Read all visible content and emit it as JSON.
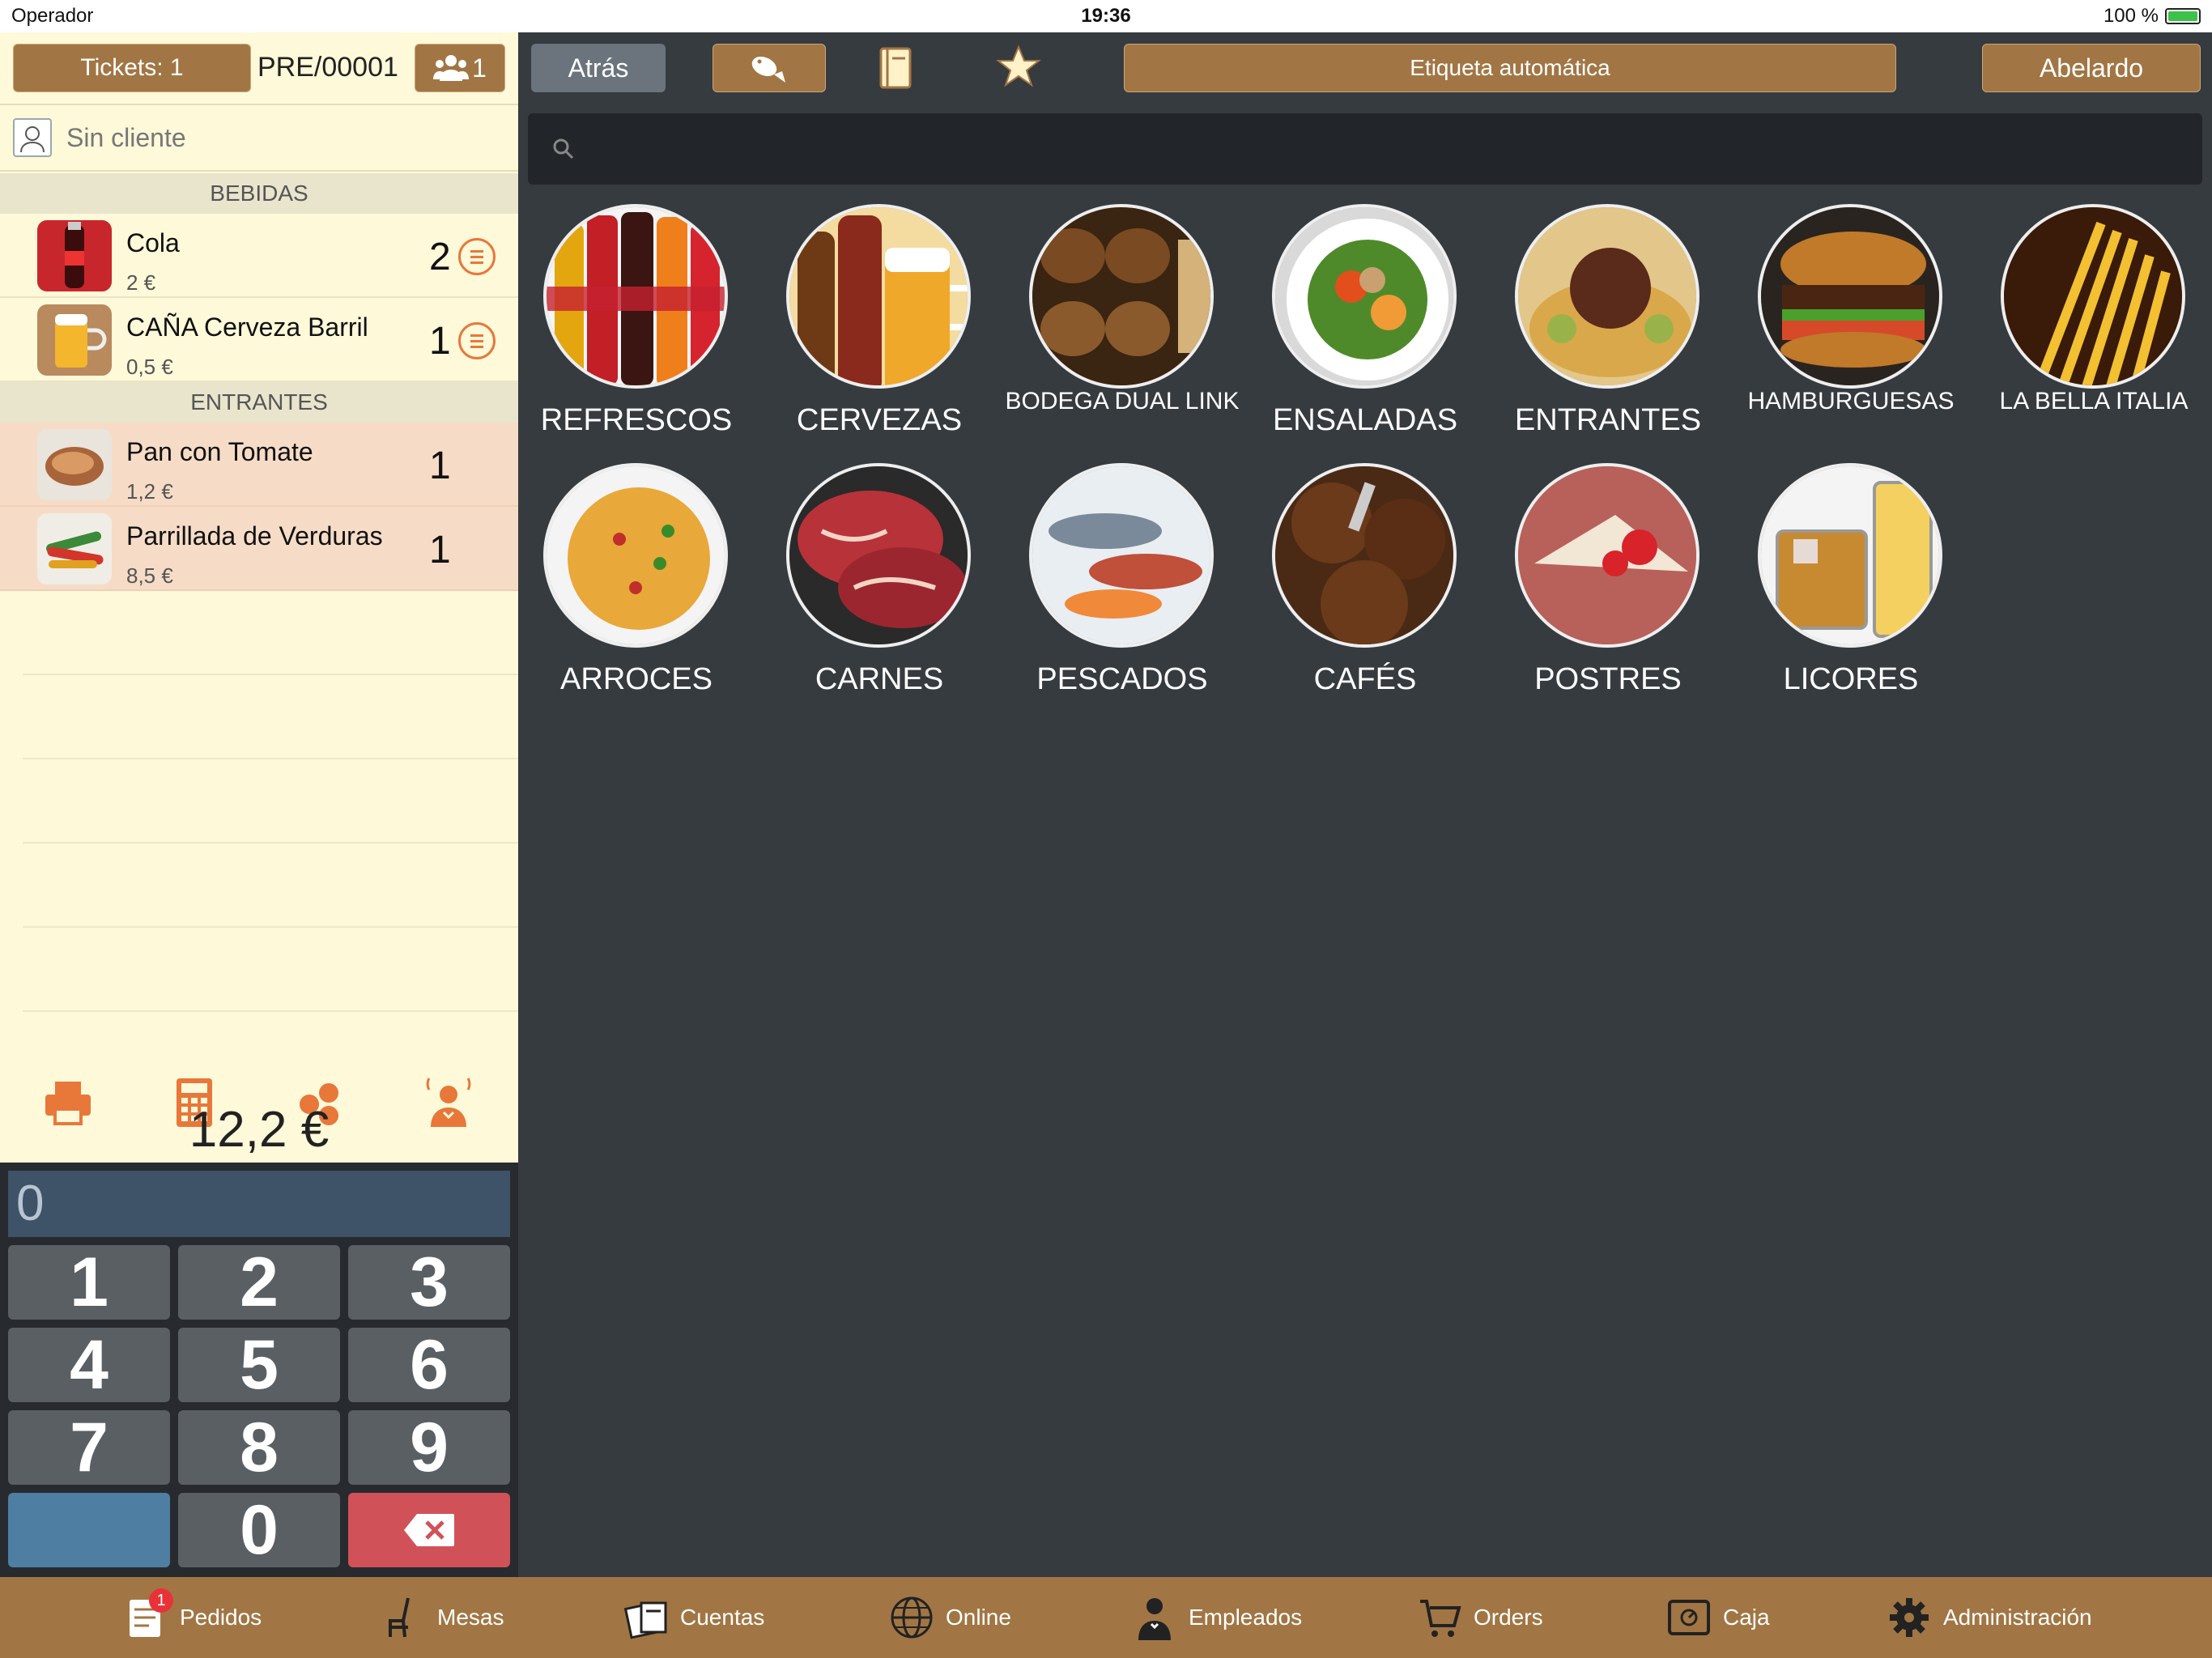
{
  "status_bar": {
    "carrier": "Operador",
    "time": "19:36",
    "battery": "100 %"
  },
  "header": {
    "tickets_label": "Tickets: 1",
    "ticket_id": "PRE/00001",
    "guests_count": "1"
  },
  "client": {
    "label": "Sin cliente"
  },
  "order": {
    "categories": [
      {
        "name": "BEBIDAS",
        "items": [
          {
            "name": "Cola",
            "price": "2 €",
            "qty": "2"
          },
          {
            "name": "CAÑA Cerveza Barril",
            "price": "0,5 €",
            "qty": "1"
          }
        ]
      },
      {
        "name": "ENTRANTES",
        "items": [
          {
            "name": "Pan con Tomate",
            "price": "1,2 €",
            "qty": "1"
          },
          {
            "name": "Parrillada de Verduras",
            "price": "8,5 €",
            "qty": "1"
          }
        ]
      }
    ],
    "total": "12,2 €"
  },
  "keypad": {
    "display": "0",
    "keys": [
      "1",
      "2",
      "3",
      "4",
      "5",
      "6",
      "7",
      "8",
      "9",
      "",
      "0"
    ]
  },
  "nav": {
    "back_label": "Atrás",
    "auto_label": "Etiqueta automática",
    "user_label": "Abelardo",
    "search_placeholder": ""
  },
  "families": [
    {
      "label": "REFRESCOS"
    },
    {
      "label": "CERVEZAS"
    },
    {
      "label": "BODEGA DUAL LINK"
    },
    {
      "label": "ENSALADAS"
    },
    {
      "label": "ENTRANTES"
    },
    {
      "label": "HAMBURGUESAS"
    },
    {
      "label": "LA BELLA ITALIA"
    },
    {
      "label": "ARROCES"
    },
    {
      "label": "CARNES"
    },
    {
      "label": "PESCADOS"
    },
    {
      "label": "CAFÉS"
    },
    {
      "label": "POSTRES"
    },
    {
      "label": "LICORES"
    }
  ],
  "tabs": [
    {
      "label": "Pedidos",
      "icon": "order-icon",
      "badge": "1"
    },
    {
      "label": "Mesas",
      "icon": "chair-icon"
    },
    {
      "label": "Cuentas",
      "icon": "accounts-icon"
    },
    {
      "label": "Online",
      "icon": "globe-icon"
    },
    {
      "label": "Empleados",
      "icon": "waiter-icon"
    },
    {
      "label": "Orders",
      "icon": "cart-icon"
    },
    {
      "label": "Caja",
      "icon": "safe-icon"
    },
    {
      "label": "Administración",
      "icon": "gear-icon"
    }
  ],
  "colors": {
    "bronze": "#a17644",
    "panel": "#fdf9d9",
    "dark": "#363b40",
    "accent": "#e8773a"
  }
}
